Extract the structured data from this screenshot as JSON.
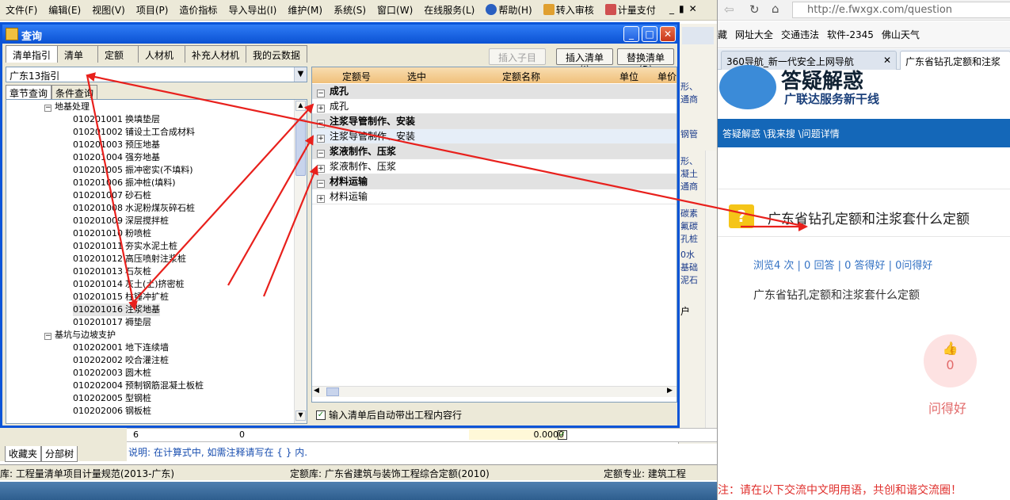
{
  "menubar": {
    "items": [
      "文件(F)",
      "编辑(E)",
      "视图(V)",
      "项目(P)",
      "造价指标",
      "导入导出(I)",
      "维护(M)",
      "系统(S)",
      "窗口(W)",
      "在线服务(L)",
      "帮助(H)",
      "转入审核",
      "计量支付"
    ],
    "controls": [
      "_",
      "▮",
      "✕"
    ]
  },
  "dialog": {
    "title": "查询",
    "tabs": [
      "清单指引",
      "清单",
      "定额",
      "人材机",
      "补充人材机",
      "我的云数据"
    ],
    "buttons": {
      "insert_child": "插入子目",
      "insert_list": "插入清单(I)",
      "replace_list": "替换清单(R)"
    },
    "combo_value": "广东13指引",
    "subtabs": [
      "章节查询",
      "条件查询"
    ],
    "tree": {
      "group1": "地基处理",
      "items": [
        {
          "code": "010201001",
          "name": "换填垫层"
        },
        {
          "code": "010201002",
          "name": "铺设土工合成材料"
        },
        {
          "code": "010201003",
          "name": "预压地基"
        },
        {
          "code": "010201004",
          "name": "强夯地基"
        },
        {
          "code": "010201005",
          "name": "振冲密实(不填料)"
        },
        {
          "code": "010201006",
          "name": "振冲桩(填料)"
        },
        {
          "code": "010201007",
          "name": "砂石桩"
        },
        {
          "code": "010201008",
          "name": "水泥粉煤灰碎石桩"
        },
        {
          "code": "010201009",
          "name": "深层搅拌桩"
        },
        {
          "code": "010201010",
          "name": "粉喷桩"
        },
        {
          "code": "010201011",
          "name": "夯实水泥土桩"
        },
        {
          "code": "010201012",
          "name": "高压喷射注浆桩"
        },
        {
          "code": "010201013",
          "name": "石灰桩"
        },
        {
          "code": "010201014",
          "name": "灰土(土)挤密桩"
        },
        {
          "code": "010201015",
          "name": "柱锤冲扩桩"
        },
        {
          "code": "010201016",
          "name": "注浆地基"
        },
        {
          "code": "010201017",
          "name": "褥垫层"
        }
      ],
      "group2": "基坑与边坡支护",
      "items2": [
        {
          "code": "010202001",
          "name": "地下连续墙"
        },
        {
          "code": "010202002",
          "name": "咬合灌注桩"
        },
        {
          "code": "010202003",
          "name": "圆木桩"
        },
        {
          "code": "010202004",
          "name": "预制钢筋混凝土板桩"
        },
        {
          "code": "010202005",
          "name": "型钢桩"
        },
        {
          "code": "010202006",
          "name": "钢板桩"
        }
      ]
    },
    "table": {
      "headers": [
        "定额号",
        "选中",
        "定额名称",
        "单位",
        "单价"
      ],
      "rows": [
        {
          "group": "成孔",
          "child": "成孔"
        },
        {
          "group": "注浆导管制作、安装",
          "child": "注浆导管制作、安装"
        },
        {
          "group": "浆液制作、压浆",
          "child": "浆液制作、压浆"
        },
        {
          "group": "材料运输",
          "child": "材料运输"
        }
      ]
    },
    "checkbox_label": "输入清单后自动带出工程内容行"
  },
  "app": {
    "bottom_tabs": [
      "收藏夹",
      "分部树"
    ],
    "row6": {
      "num": "6",
      "val": "0",
      "price": "0.0000"
    },
    "hint": "说明: 在计算式中, 如需注释请写在 { } 内.",
    "status": {
      "list_lib": "库: 工程量清单项目计量规范(2013-广东)",
      "quota_lib": "定额库: 广东省建筑与装饰工程综合定额(2010)",
      "specialty": "定额专业: 建筑工程"
    },
    "peek_texts": [
      "形、",
      "通商",
      "钢管",
      "形、",
      "凝土",
      "通商",
      "碳素",
      "氟碳",
      "孔桩",
      "0水",
      "基础",
      "泥石"
    ],
    "peek_user": "户"
  },
  "browser": {
    "url": "http://e.fwxgx.com/question",
    "favorites": [
      "藏",
      "网址大全",
      "交通违法",
      "软件-2345",
      "佛山天气"
    ],
    "tabs": [
      "360导航_新一代安全上网导航",
      "广东省钻孔定额和注浆"
    ],
    "hero_title": "答疑解惑",
    "hero_sub": "广联达服务新干线",
    "breadcrumb": "答疑解惑 \\我来搜 \\问题详情",
    "question_title": "广东省钻孔定额和注浆套什么定额",
    "stats": "浏览4 次 | 0 回答 | 0 答得好 | 0问得好",
    "question_body": "广东省钻孔定额和注浆套什么定额",
    "like_count": "0",
    "like_label": "问得好",
    "notice": "注：请在以下交流中文明用语，共创和谐交流圈！"
  },
  "colors": {
    "accent_blue": "#0a54d8",
    "arrow_red": "#e8201c",
    "browser_blue": "#1467b8"
  }
}
